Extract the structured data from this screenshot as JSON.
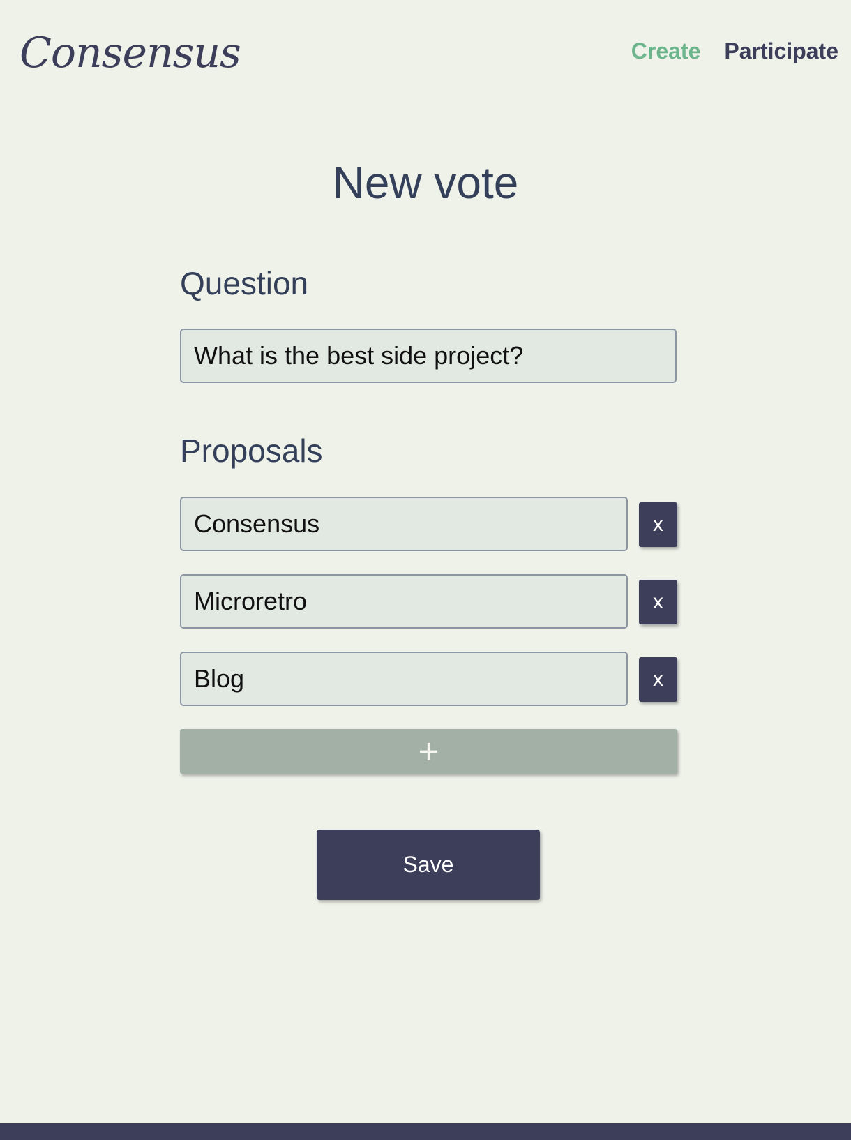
{
  "brand": {
    "logo_text": "Consensus"
  },
  "nav": {
    "items": [
      {
        "label": "Create",
        "active": true
      },
      {
        "label": "Participate",
        "active": false
      }
    ],
    "active_color": "#6bb48c",
    "default_color": "#3d3e5a"
  },
  "page": {
    "title": "New vote"
  },
  "question": {
    "label": "Question",
    "value": "What is the best side project?"
  },
  "proposals": {
    "label": "Proposals",
    "items": [
      {
        "value": "Consensus",
        "remove_label": "x"
      },
      {
        "value": "Microretro",
        "remove_label": "x"
      },
      {
        "value": "Blog",
        "remove_label": "x"
      }
    ],
    "add_label": "+"
  },
  "actions": {
    "save_label": "Save"
  },
  "colors": {
    "background": "#eff2e9",
    "primary": "#3d3e5a",
    "accent": "#6bb48c",
    "add_button": "#a2b0a6"
  }
}
